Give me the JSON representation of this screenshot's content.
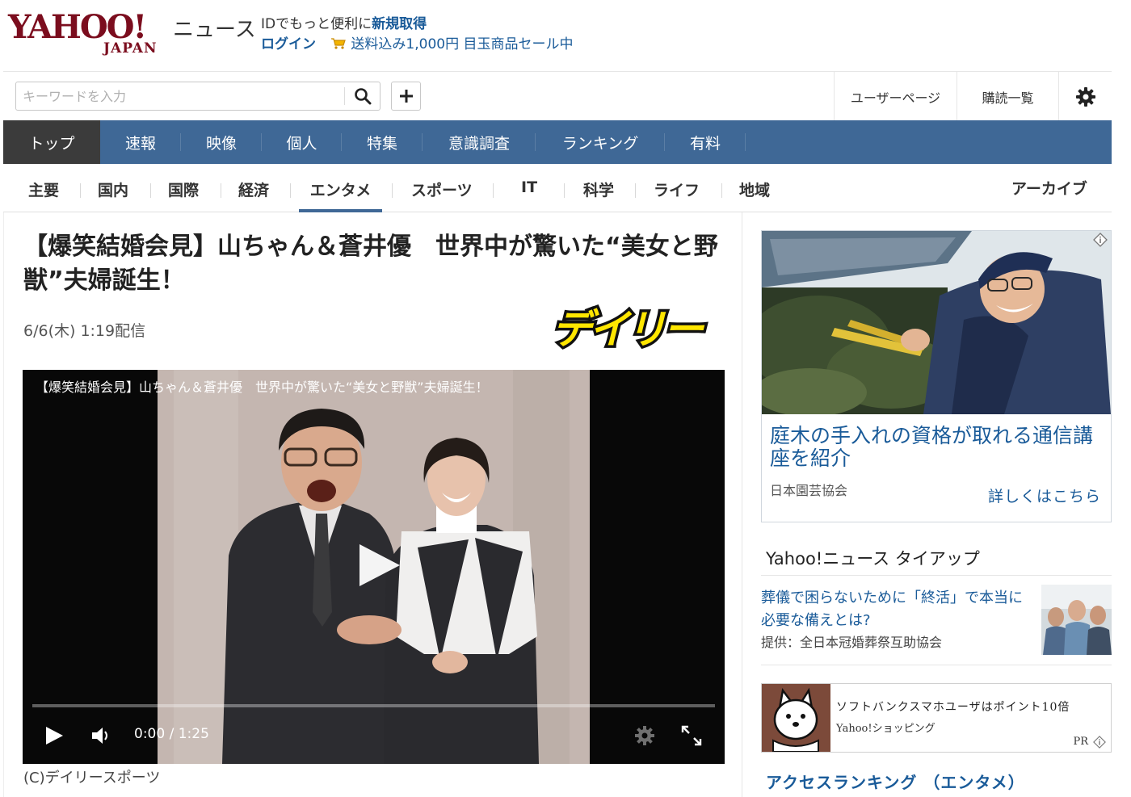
{
  "header": {
    "logo_main": "YAHOO!",
    "logo_sub": "JAPAN",
    "logo_news": "ニュース",
    "promo_text": "IDでもっと便利に",
    "promo_link": "新規取得",
    "login": "ログイン",
    "shopping_promo": "送料込み1,000円 目玉商品セール中"
  },
  "search": {
    "placeholder": "キーワードを入力",
    "search_icon": "search-icon",
    "add_icon": "plus-icon"
  },
  "user_tools": {
    "user_page": "ユーザーページ",
    "subscriptions": "購読一覧",
    "settings_icon": "gear-icon"
  },
  "main_nav": {
    "tabs": [
      {
        "label": "トップ",
        "active": true
      },
      {
        "label": "速報"
      },
      {
        "label": "映像"
      },
      {
        "label": "個人"
      },
      {
        "label": "特集"
      },
      {
        "label": "意識調査"
      },
      {
        "label": "ランキング"
      },
      {
        "label": "有料"
      }
    ]
  },
  "sub_nav": {
    "tabs": [
      {
        "label": "主要"
      },
      {
        "label": "国内"
      },
      {
        "label": "国際"
      },
      {
        "label": "経済"
      },
      {
        "label": "エンタメ",
        "active": true
      },
      {
        "label": "スポーツ"
      },
      {
        "label": "IT"
      },
      {
        "label": "科学"
      },
      {
        "label": "ライフ"
      },
      {
        "label": "地域"
      }
    ],
    "archive": "アーカイブ"
  },
  "article": {
    "headline": "【爆笑結婚会見】山ちゃん＆蒼井優　世界中が驚いた“美女と野獣”夫婦誕生！",
    "date": "6/6(木) 1:19配信",
    "source_logo_text": "デイリー",
    "video": {
      "title": "【爆笑結婚会見】山ちゃん＆蒼井優　世界中が驚いた“美女と野獣”夫婦誕生！",
      "time": "0:00 / 1:25",
      "progress": 0
    },
    "credit": "(C)デイリースポーツ"
  },
  "sidebar": {
    "ad1": {
      "title": "庭木の手入れの資格が取れる通信講座を紹介",
      "sponsor": "日本園芸協会",
      "more": "詳しくはこちら"
    },
    "tieup": {
      "section_title": "Yahoo!ニュース タイアップ",
      "text": "葬儀で困らないために「終活」で本当に必要な備えとは?",
      "source": "提供：全日本冠婚葬祭互助協会"
    },
    "ad2": {
      "title": "ソフトバンクスマホユーザはポイント10倍",
      "sub": "Yahoo!ショッピング",
      "pr": "PR"
    },
    "ranking_title": "アクセスランキング （エンタメ）"
  },
  "colors": {
    "nav_blue": "#3f6896",
    "nav_active": "#3b3b3b",
    "link_blue": "#1a5b99",
    "logo_red": "#7b0d1e",
    "daily_yellow": "#ffe600"
  }
}
